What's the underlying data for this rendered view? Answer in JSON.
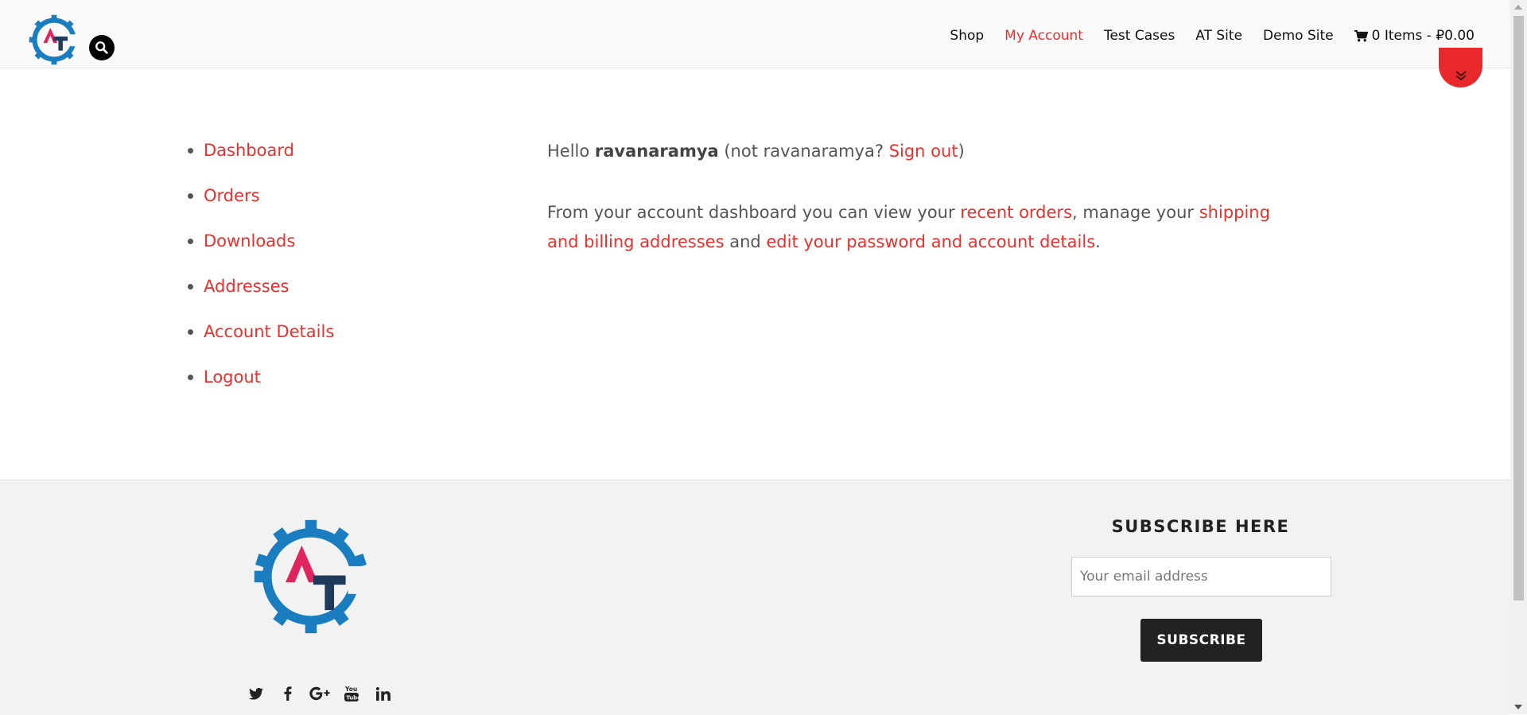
{
  "header": {
    "logo_alt": "AT",
    "nav": [
      {
        "label": "Shop",
        "active": false
      },
      {
        "label": "My Account",
        "active": true
      },
      {
        "label": "Test Cases",
        "active": false
      },
      {
        "label": "AT Site",
        "active": false
      },
      {
        "label": "Demo Site",
        "active": false
      }
    ],
    "cart_label": "0 Items - ₽0.00",
    "icons": [
      "search-icon",
      "cart-icon",
      "chevrons-down-icon"
    ]
  },
  "account_nav": [
    {
      "label": "Dashboard"
    },
    {
      "label": "Orders"
    },
    {
      "label": "Downloads"
    },
    {
      "label": "Addresses"
    },
    {
      "label": "Account Details"
    },
    {
      "label": "Logout"
    }
  ],
  "dashboard": {
    "hello": "Hello ",
    "username": "ravanaramya",
    "not_user_prefix": " (not ravanaramya? ",
    "sign_out": "Sign out",
    "not_user_suffix": ")",
    "intro": "From your account dashboard you can view your ",
    "recent_orders": "recent orders",
    "manage": ", manage your ",
    "addresses_link": "shipping and billing addresses",
    "and": " and ",
    "edit_link": "edit your password and account details",
    "period": "."
  },
  "footer": {
    "subscribe_title": "SUBSCRIBE HERE",
    "email_placeholder": "Your email address",
    "subscribe_button": "SUBSCRIBE",
    "social_icons": [
      "twitter-icon",
      "facebook-icon",
      "google-plus-icon",
      "youtube-icon",
      "linkedin-icon"
    ]
  },
  "colors": {
    "accent": "#e8312f",
    "logo_blue": "#1a7dc0",
    "logo_red": "#e0245e",
    "logo_navy": "#1f3a5a"
  }
}
